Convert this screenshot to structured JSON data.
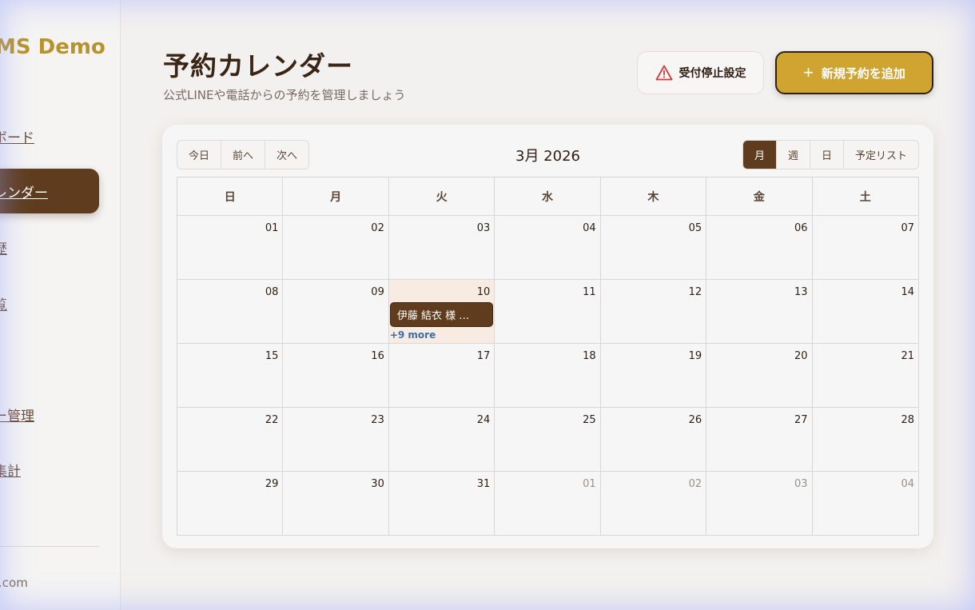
{
  "sidebar": {
    "brand": "MS Demo",
    "items": [
      {
        "label": "ボード",
        "top": 0
      },
      {
        "label": "レンダー"
      },
      {
        "label": "歴"
      },
      {
        "label": "覧"
      },
      {
        "label": "ー管理"
      },
      {
        "label": "集計"
      }
    ],
    "email": ".com"
  },
  "header": {
    "title": "予約カレンダー",
    "subtitle": "公式LINEや電話からの予約を管理しましょう",
    "stop_button": "受付停止設定",
    "add_button": "新規予約を追加"
  },
  "calendar": {
    "nav": [
      "今日",
      "前へ",
      "次へ"
    ],
    "title": "3月 2026",
    "views": [
      "月",
      "週",
      "日",
      "予定リスト"
    ],
    "active_view": "月",
    "weekdays": [
      "日",
      "月",
      "火",
      "水",
      "木",
      "金",
      "土"
    ],
    "weeks": [
      [
        "01",
        "02",
        "03",
        "04",
        "05",
        "06",
        "07"
      ],
      [
        "08",
        "09",
        "10",
        "11",
        "12",
        "13",
        "14"
      ],
      [
        "15",
        "16",
        "17",
        "18",
        "19",
        "20",
        "21"
      ],
      [
        "22",
        "23",
        "24",
        "25",
        "26",
        "27",
        "28"
      ],
      [
        "29",
        "30",
        "31",
        "01",
        "02",
        "03",
        "04"
      ]
    ],
    "event": {
      "day": "10",
      "label": "伊藤 結衣 様 …",
      "more": "+9 more"
    }
  },
  "colors": {
    "accent": "#5f3c1d",
    "gold": "#cfa431",
    "brand": "#b8932c",
    "link": "#3b6ea8",
    "warning": "#d33c3c"
  }
}
